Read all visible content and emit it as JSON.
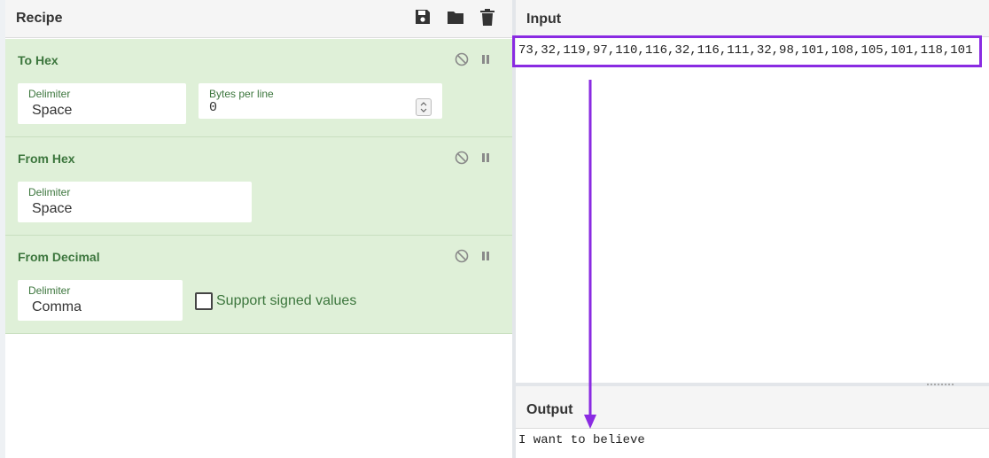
{
  "recipe": {
    "title": "Recipe",
    "toolbar": {
      "save_icon": "save-icon",
      "folder_icon": "folder-icon",
      "trash_icon": "trash-icon"
    },
    "operations": [
      {
        "title": "To Hex",
        "fields": [
          {
            "label": "Delimiter",
            "value": "Space"
          },
          {
            "label": "Bytes per line",
            "value": "0"
          }
        ]
      },
      {
        "title": "From Hex",
        "fields": [
          {
            "label": "Delimiter",
            "value": "Space"
          }
        ]
      },
      {
        "title": "From Decimal",
        "fields": [
          {
            "label": "Delimiter",
            "value": "Comma"
          }
        ],
        "checkbox": {
          "label": "Support signed values",
          "checked": false
        }
      }
    ]
  },
  "input": {
    "title": "Input",
    "text": "73,32,119,97,110,116,32,116,111,32,98,101,108,105,101,118,101"
  },
  "output": {
    "title": "Output",
    "text": "I want to believe"
  },
  "colors": {
    "operation_bg": "#dff0d8",
    "operation_text": "#3c763d",
    "highlight": "#8a2be2"
  }
}
